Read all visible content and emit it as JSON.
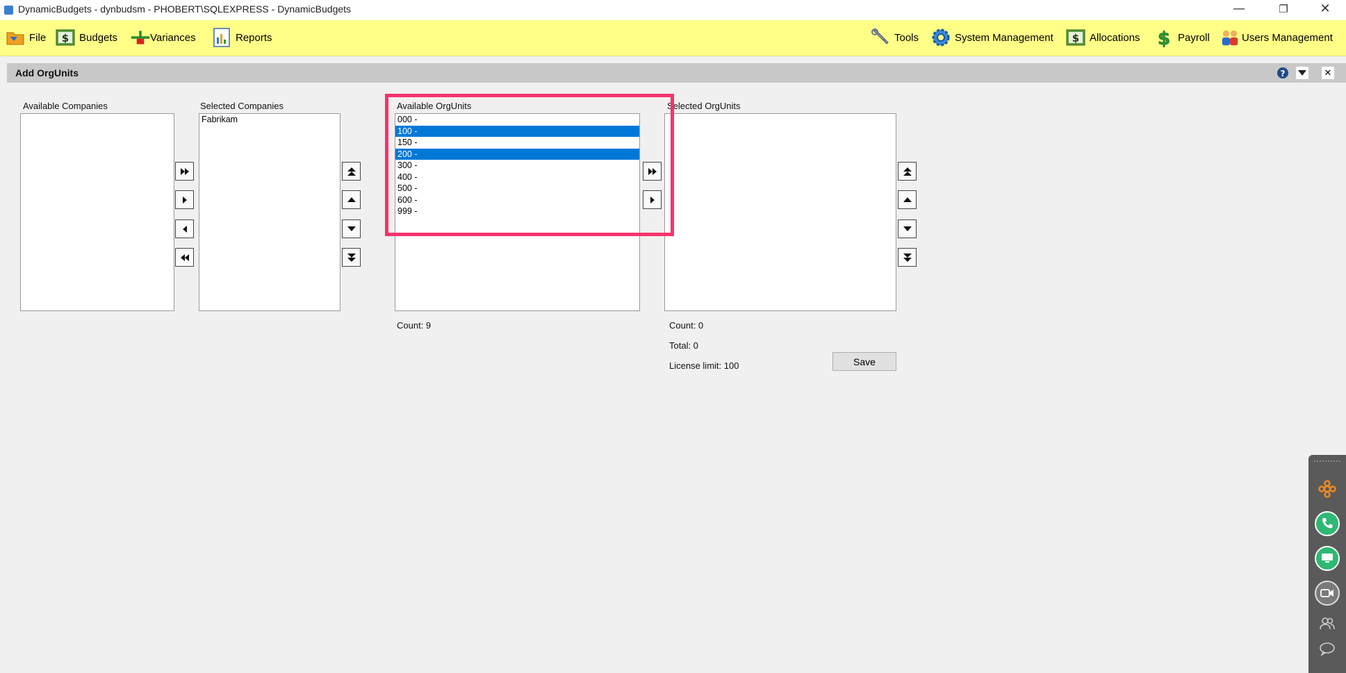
{
  "window": {
    "title": "DynamicBudgets - dynbudsm - PHOBERT\\SQLEXPRESS - DynamicBudgets",
    "minimize": "—",
    "restore": "❐",
    "close": "✕"
  },
  "toolbar": {
    "left": [
      {
        "label": "File",
        "icon": "folder-icon"
      },
      {
        "label": "Budgets",
        "icon": "dollar-icon"
      },
      {
        "label": "Variances",
        "icon": "plus-minus-icon"
      },
      {
        "label": "Reports",
        "icon": "report-icon"
      }
    ],
    "right": [
      {
        "label": "Tools",
        "icon": "wrench-icon"
      },
      {
        "label": "System Management",
        "icon": "gear-icon"
      },
      {
        "label": "Allocations",
        "icon": "dollar-icon"
      },
      {
        "label": "Payroll",
        "icon": "money-icon"
      },
      {
        "label": "Users Management",
        "icon": "users-icon"
      }
    ]
  },
  "panel": {
    "title": "Add OrgUnits",
    "help": "?",
    "close": "✕"
  },
  "available_companies": {
    "label": "Available Companies",
    "items": []
  },
  "selected_companies": {
    "label": "Selected Companies",
    "items": [
      "Fabrikam"
    ]
  },
  "available_orgunits": {
    "label": "Available OrgUnits",
    "items": [
      {
        "text": "000 -",
        "selected": false
      },
      {
        "text": "100 -",
        "selected": true
      },
      {
        "text": "150 -",
        "selected": false
      },
      {
        "text": "200 -",
        "selected": true
      },
      {
        "text": "300 -",
        "selected": false
      },
      {
        "text": "400 -",
        "selected": false
      },
      {
        "text": "500 -",
        "selected": false
      },
      {
        "text": "600 -",
        "selected": false
      },
      {
        "text": "999 -",
        "selected": false
      }
    ],
    "count": "Count: 9"
  },
  "selected_orgunits": {
    "label": "Selected OrgUnits",
    "items": [],
    "count": "Count: 0",
    "total": "Total: 0",
    "license_limit": "License limit: 100"
  },
  "save_label": "Save",
  "colors": {
    "toolbar_bg": "#ffff88",
    "selection": "#0078d7",
    "highlight": "#f7336c"
  }
}
